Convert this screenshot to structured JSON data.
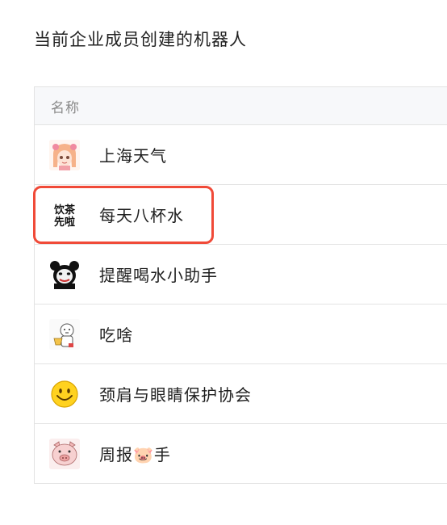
{
  "section": {
    "title": "当前企业成员创建的机器人"
  },
  "table": {
    "header": "名称",
    "rows": [
      {
        "name": "上海天气",
        "icon": "anime-girl-avatar"
      },
      {
        "name": "每天八杯水",
        "icon": "drink-tea-text-avatar",
        "avatar_text": [
          "饮茶",
          "先啦"
        ]
      },
      {
        "name": "提醒喝水小助手",
        "icon": "panda-meme-avatar"
      },
      {
        "name": "吃啥",
        "icon": "cartoon-eater-avatar"
      },
      {
        "name": "颈肩与眼睛保护协会",
        "icon": "smiley-face-avatar"
      },
      {
        "name": "周报🐷手",
        "icon": "pig-avatar"
      }
    ]
  },
  "colors": {
    "highlight": "#f04a38",
    "border": "#e3e3e3",
    "header_bg": "#f7f8fa"
  }
}
